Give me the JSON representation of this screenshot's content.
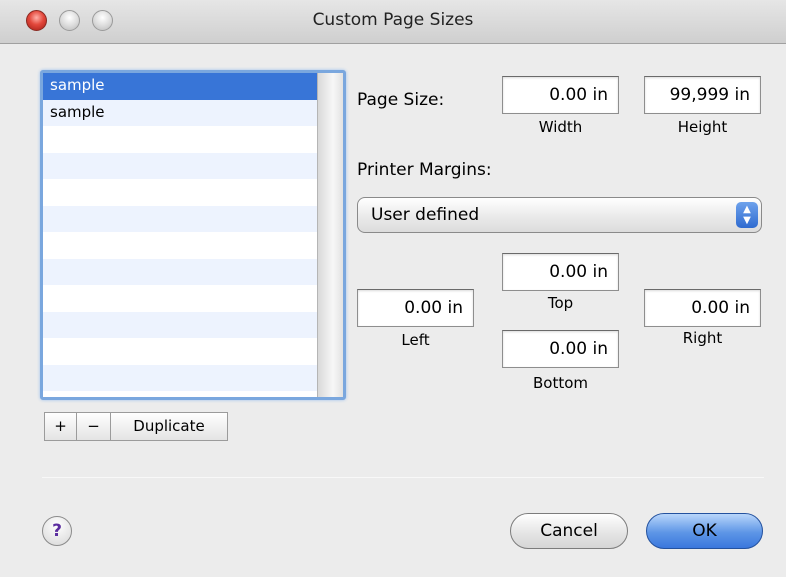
{
  "window": {
    "title": "Custom Page Sizes"
  },
  "list": {
    "items": [
      "sample",
      "sample",
      "",
      "",
      "",
      "",
      "",
      "",
      "",
      "",
      "",
      ""
    ],
    "selected_index": 0
  },
  "list_buttons": {
    "add": "+",
    "remove": "−",
    "duplicate": "Duplicate"
  },
  "page_size": {
    "label": "Page Size:",
    "width_value": "0.00 in",
    "width_label": "Width",
    "height_value": "99,999 in",
    "height_label": "Height"
  },
  "margins": {
    "label": "Printer Margins:",
    "popup_value": "User defined",
    "top_value": "0.00 in",
    "top_label": "Top",
    "left_value": "0.00 in",
    "left_label": "Left",
    "right_value": "0.00 in",
    "right_label": "Right",
    "bottom_value": "0.00 in",
    "bottom_label": "Bottom"
  },
  "footer": {
    "help": "?",
    "cancel": "Cancel",
    "ok": "OK"
  },
  "colors": {
    "accent": "#3875d7",
    "row_alt": "#edf3fe",
    "background": "#ececec"
  }
}
